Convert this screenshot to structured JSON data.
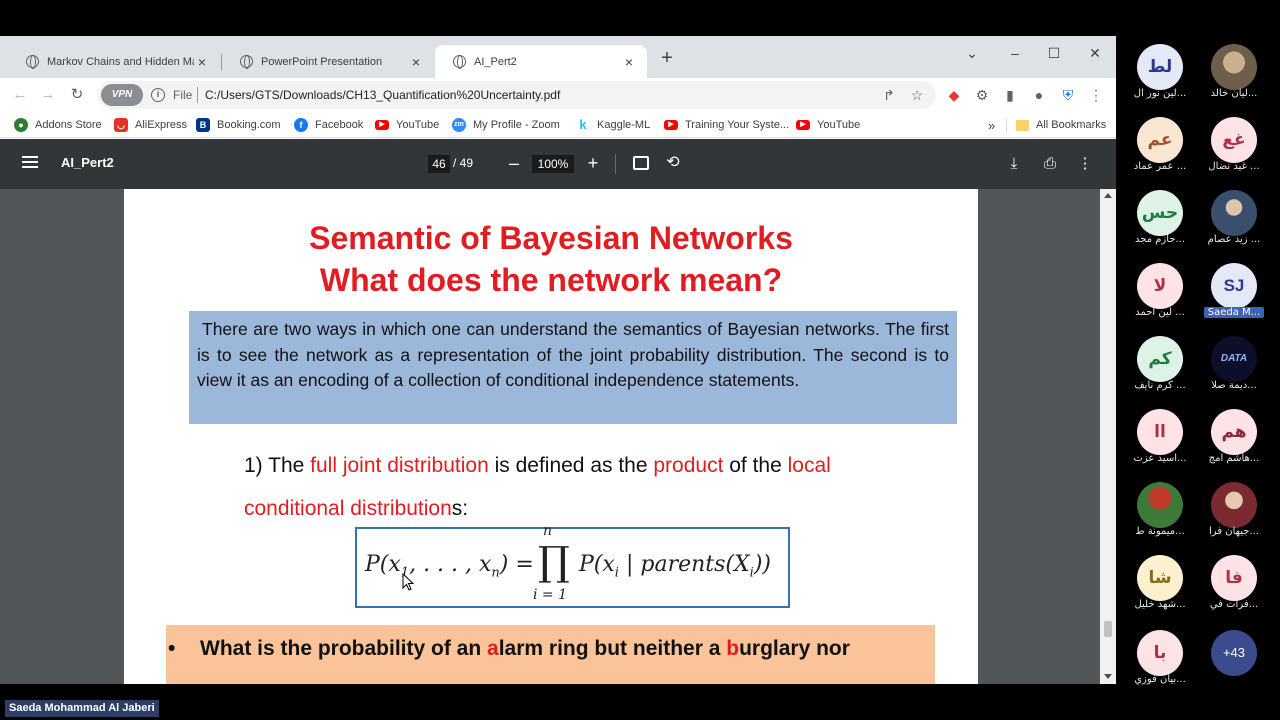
{
  "browser": {
    "tabs": [
      {
        "title": "Markov Chains and Hidden Mar"
      },
      {
        "title": "PowerPoint Presentation"
      },
      {
        "title": "AI_Pert2"
      }
    ],
    "omnibox": {
      "vpn": "VPN",
      "scheme": "File",
      "url": "C:/Users/GTS/Downloads/CH13_Quantification%20Uncertainty.pdf"
    },
    "bookmarks": [
      {
        "label": "Addons Store",
        "color": "#2e7d32"
      },
      {
        "label": "AliExpress",
        "color": "#e43225"
      },
      {
        "label": "Booking.com",
        "color": "#003580",
        "glyph": "B"
      },
      {
        "label": "Facebook",
        "color": "#1877f2",
        "glyph": "f"
      },
      {
        "label": "YouTube",
        "color": "#ff0000"
      },
      {
        "label": "My Profile - Zoom",
        "color": "#2d8cff",
        "glyph": "zm"
      },
      {
        "label": "Kaggle-ML",
        "color": "#20beff",
        "glyph": "k"
      },
      {
        "label": "Training Your Syste...",
        "color": "#ff0000"
      },
      {
        "label": "YouTube",
        "color": "#ff0000"
      }
    ],
    "all_bookmarks": "All Bookmarks",
    "overflow": "»"
  },
  "pdf": {
    "title": "AI_Pert2",
    "page_current": "46",
    "page_total": "/ 49",
    "zoom": "100%"
  },
  "slide": {
    "title_line1": "Semantic of Bayesian Networks",
    "title_line2": "What does the network mean?",
    "intro": "There are two ways in which one can understand the semantics of Bayesian networks. The first is to see the network as a representation of the joint probability distribution. The second is to view it as an encoding of a collection of conditional independence statements.",
    "point1": {
      "prefix": "1) The ",
      "term1": "full joint distribution",
      "mid1": " is defined as the ",
      "term2": "product",
      "mid2": " of the ",
      "term3": "local",
      "term4": "conditional distribution",
      "suffix": "s:"
    },
    "formula": {
      "lhs": "P(x",
      "lhs_sub1": "1",
      "lhs_mid": ", . . . , x",
      "lhs_subn": "n",
      "lhs_end": ") =",
      "prod": "∏",
      "prod_upper": "n",
      "prod_lower": "i = 1",
      "rhs": "P(x",
      "rhs_sub": "i",
      "rhs_mid": " | parents(X",
      "rhs_end": "))"
    },
    "question": {
      "bullet": "•",
      "pre": "What is the probability of an ",
      "a": "a",
      "mid": "larm ring but neither a ",
      "b": "b",
      "post": "urglary nor"
    }
  },
  "participants": [
    {
      "initials": "لط",
      "name": "لين نور ال...",
      "bg": "#e5e9f7",
      "fg": "#2d3a8c"
    },
    {
      "initials": "",
      "name": "ليان خالد...",
      "bg": "#8d7a66",
      "fg": "#fff",
      "photo": true
    },
    {
      "initials": "عم",
      "name": "عمر عماد ...",
      "bg": "#fbe6d4",
      "fg": "#a0522d"
    },
    {
      "initials": "غع",
      "name": "غيد نضال ...",
      "bg": "#fde3e6",
      "fg": "#b03048"
    },
    {
      "initials": "حس",
      "name": "حازم مجد...",
      "bg": "#dff2e6",
      "fg": "#1f7a44"
    },
    {
      "initials": "",
      "name": "زيد عصام ...",
      "bg": "#6a86a6",
      "fg": "#fff",
      "photo": true
    },
    {
      "initials": "لا",
      "name": "لين احمد ...",
      "bg": "#fde3e6",
      "fg": "#b03048"
    },
    {
      "initials": "SJ",
      "name": "Saeda M...",
      "bg": "#e5e9f7",
      "fg": "#2d3a8c",
      "highlight": true
    },
    {
      "initials": "كم",
      "name": "كرم نايف ...",
      "bg": "#dff2e6",
      "fg": "#1f7a44"
    },
    {
      "initials": "DATA",
      "name": "ديمة صلا...",
      "bg": "#0d0f2a",
      "fg": "#8fb4ff",
      "photo": true
    },
    {
      "initials": "اا",
      "name": "اسيد عزت...",
      "bg": "#fde3e6",
      "fg": "#b03048"
    },
    {
      "initials": "هم",
      "name": "هاشم امج...",
      "bg": "#fde3e6",
      "fg": "#8a2a3c"
    },
    {
      "initials": "",
      "name": "ميمونة ط...",
      "bg": "#3d7a3a",
      "fg": "#fff",
      "photo": true
    },
    {
      "initials": "",
      "name": "جيهان فرا...",
      "bg": "#7a2a30",
      "fg": "#fff",
      "photo": true
    },
    {
      "initials": "شا",
      "name": "شهد خليل...",
      "bg": "#fbf1cf",
      "fg": "#8a6d12"
    },
    {
      "initials": "فا",
      "name": "فرات في...",
      "bg": "#fde3e6",
      "fg": "#b03048"
    },
    {
      "initials": "با",
      "name": "بيان فوزي...",
      "bg": "#fde3e6",
      "fg": "#b03048"
    }
  ],
  "more_participants": "+43",
  "speaker": "Saeda Mohammad Al Jaberi",
  "icons": [
    "globe-icon",
    "close-icon",
    "plus-icon",
    "minimize-icon",
    "maximize-icon",
    "back-icon",
    "forward-icon",
    "reload-icon",
    "info-icon",
    "share-icon",
    "star-icon",
    "extension-icon",
    "profile-icon",
    "menu-icon",
    "download-icon",
    "print-icon",
    "rotate-icon",
    "fit-page-icon",
    "cursor-icon"
  ]
}
